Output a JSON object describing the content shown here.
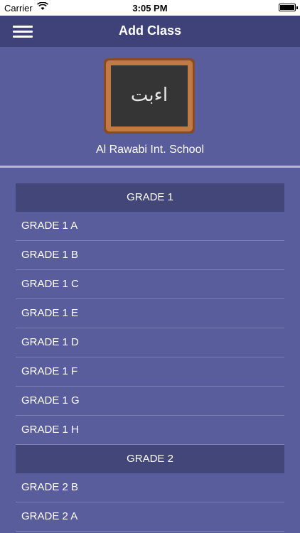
{
  "status_bar": {
    "carrier": "Carrier",
    "time": "3:05 PM"
  },
  "nav": {
    "title": "Add Class",
    "menu_icon": "hamburger-menu-icon"
  },
  "header": {
    "school_name": "Al Rawabi Int. School",
    "logo_text": "اءبت"
  },
  "sections": [
    {
      "title": "GRADE 1",
      "rows": [
        "GRADE 1 A",
        "GRADE 1 B",
        "GRADE 1 C",
        "GRADE 1 E",
        "GRADE 1 D",
        "GRADE 1 F",
        "GRADE 1 G",
        "GRADE 1 H"
      ]
    },
    {
      "title": "GRADE 2",
      "rows": [
        "GRADE 2 B",
        "GRADE 2 A"
      ]
    }
  ],
  "colors": {
    "nav_bg": "#3f4278",
    "body_bg": "#5a5d9b",
    "section_bg": "#434679"
  }
}
